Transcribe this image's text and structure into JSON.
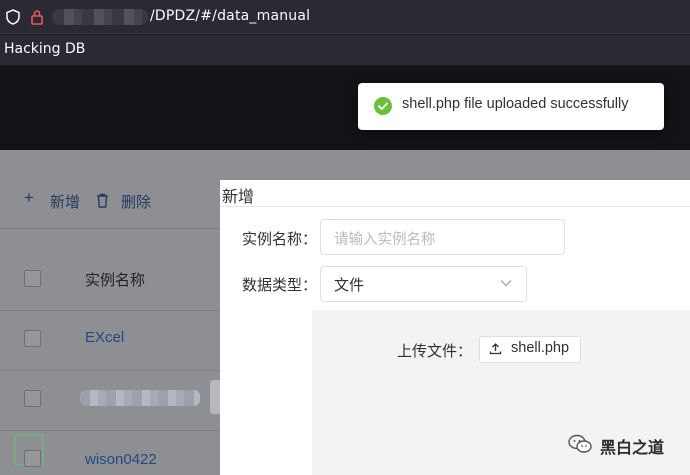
{
  "browser": {
    "url_visible": "/DPDZ/#/data_manual",
    "bookmark_label": "Hacking DB"
  },
  "toast": {
    "message": "shell.php file uploaded successfully",
    "color": "#67c23a"
  },
  "toolbar": {
    "add_label": "新增",
    "delete_label": "删除",
    "plus_symbol": "+"
  },
  "table": {
    "column_header": "实例名称",
    "rows": [
      {
        "name": "EXcel"
      },
      {
        "name": ""
      },
      {
        "name": "wison0422"
      }
    ]
  },
  "dialog": {
    "title": "新增",
    "name_label": "实例名称：",
    "name_placeholder": "请输入实例名称",
    "type_label": "数据类型：",
    "type_value": "文件",
    "upload_label": "上传文件：",
    "upload_file": "shell.php"
  },
  "watermark": {
    "text": "黑白之道",
    "icon": "wechat-icon"
  }
}
